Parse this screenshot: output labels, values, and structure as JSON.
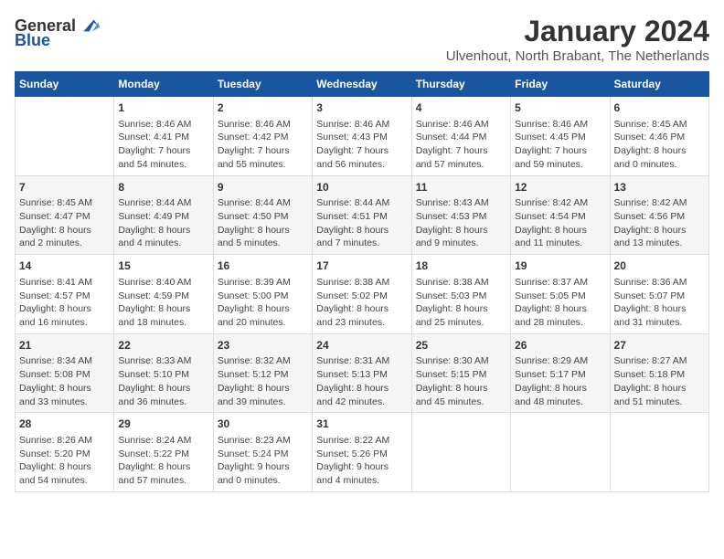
{
  "logo": {
    "general": "General",
    "blue": "Blue"
  },
  "title": "January 2024",
  "subtitle": "Ulvenhout, North Brabant, The Netherlands",
  "days_header": [
    "Sunday",
    "Monday",
    "Tuesday",
    "Wednesday",
    "Thursday",
    "Friday",
    "Saturday"
  ],
  "weeks": [
    [
      {
        "day": "",
        "info": ""
      },
      {
        "day": "1",
        "info": "Sunrise: 8:46 AM\nSunset: 4:41 PM\nDaylight: 7 hours\nand 54 minutes."
      },
      {
        "day": "2",
        "info": "Sunrise: 8:46 AM\nSunset: 4:42 PM\nDaylight: 7 hours\nand 55 minutes."
      },
      {
        "day": "3",
        "info": "Sunrise: 8:46 AM\nSunset: 4:43 PM\nDaylight: 7 hours\nand 56 minutes."
      },
      {
        "day": "4",
        "info": "Sunrise: 8:46 AM\nSunset: 4:44 PM\nDaylight: 7 hours\nand 57 minutes."
      },
      {
        "day": "5",
        "info": "Sunrise: 8:46 AM\nSunset: 4:45 PM\nDaylight: 7 hours\nand 59 minutes."
      },
      {
        "day": "6",
        "info": "Sunrise: 8:45 AM\nSunset: 4:46 PM\nDaylight: 8 hours\nand 0 minutes."
      }
    ],
    [
      {
        "day": "7",
        "info": "Sunrise: 8:45 AM\nSunset: 4:47 PM\nDaylight: 8 hours\nand 2 minutes."
      },
      {
        "day": "8",
        "info": "Sunrise: 8:44 AM\nSunset: 4:49 PM\nDaylight: 8 hours\nand 4 minutes."
      },
      {
        "day": "9",
        "info": "Sunrise: 8:44 AM\nSunset: 4:50 PM\nDaylight: 8 hours\nand 5 minutes."
      },
      {
        "day": "10",
        "info": "Sunrise: 8:44 AM\nSunset: 4:51 PM\nDaylight: 8 hours\nand 7 minutes."
      },
      {
        "day": "11",
        "info": "Sunrise: 8:43 AM\nSunset: 4:53 PM\nDaylight: 8 hours\nand 9 minutes."
      },
      {
        "day": "12",
        "info": "Sunrise: 8:42 AM\nSunset: 4:54 PM\nDaylight: 8 hours\nand 11 minutes."
      },
      {
        "day": "13",
        "info": "Sunrise: 8:42 AM\nSunset: 4:56 PM\nDaylight: 8 hours\nand 13 minutes."
      }
    ],
    [
      {
        "day": "14",
        "info": "Sunrise: 8:41 AM\nSunset: 4:57 PM\nDaylight: 8 hours\nand 16 minutes."
      },
      {
        "day": "15",
        "info": "Sunrise: 8:40 AM\nSunset: 4:59 PM\nDaylight: 8 hours\nand 18 minutes."
      },
      {
        "day": "16",
        "info": "Sunrise: 8:39 AM\nSunset: 5:00 PM\nDaylight: 8 hours\nand 20 minutes."
      },
      {
        "day": "17",
        "info": "Sunrise: 8:38 AM\nSunset: 5:02 PM\nDaylight: 8 hours\nand 23 minutes."
      },
      {
        "day": "18",
        "info": "Sunrise: 8:38 AM\nSunset: 5:03 PM\nDaylight: 8 hours\nand 25 minutes."
      },
      {
        "day": "19",
        "info": "Sunrise: 8:37 AM\nSunset: 5:05 PM\nDaylight: 8 hours\nand 28 minutes."
      },
      {
        "day": "20",
        "info": "Sunrise: 8:36 AM\nSunset: 5:07 PM\nDaylight: 8 hours\nand 31 minutes."
      }
    ],
    [
      {
        "day": "21",
        "info": "Sunrise: 8:34 AM\nSunset: 5:08 PM\nDaylight: 8 hours\nand 33 minutes."
      },
      {
        "day": "22",
        "info": "Sunrise: 8:33 AM\nSunset: 5:10 PM\nDaylight: 8 hours\nand 36 minutes."
      },
      {
        "day": "23",
        "info": "Sunrise: 8:32 AM\nSunset: 5:12 PM\nDaylight: 8 hours\nand 39 minutes."
      },
      {
        "day": "24",
        "info": "Sunrise: 8:31 AM\nSunset: 5:13 PM\nDaylight: 8 hours\nand 42 minutes."
      },
      {
        "day": "25",
        "info": "Sunrise: 8:30 AM\nSunset: 5:15 PM\nDaylight: 8 hours\nand 45 minutes."
      },
      {
        "day": "26",
        "info": "Sunrise: 8:29 AM\nSunset: 5:17 PM\nDaylight: 8 hours\nand 48 minutes."
      },
      {
        "day": "27",
        "info": "Sunrise: 8:27 AM\nSunset: 5:18 PM\nDaylight: 8 hours\nand 51 minutes."
      }
    ],
    [
      {
        "day": "28",
        "info": "Sunrise: 8:26 AM\nSunset: 5:20 PM\nDaylight: 8 hours\nand 54 minutes."
      },
      {
        "day": "29",
        "info": "Sunrise: 8:24 AM\nSunset: 5:22 PM\nDaylight: 8 hours\nand 57 minutes."
      },
      {
        "day": "30",
        "info": "Sunrise: 8:23 AM\nSunset: 5:24 PM\nDaylight: 9 hours\nand 0 minutes."
      },
      {
        "day": "31",
        "info": "Sunrise: 8:22 AM\nSunset: 5:26 PM\nDaylight: 9 hours\nand 4 minutes."
      },
      {
        "day": "",
        "info": ""
      },
      {
        "day": "",
        "info": ""
      },
      {
        "day": "",
        "info": ""
      }
    ]
  ]
}
